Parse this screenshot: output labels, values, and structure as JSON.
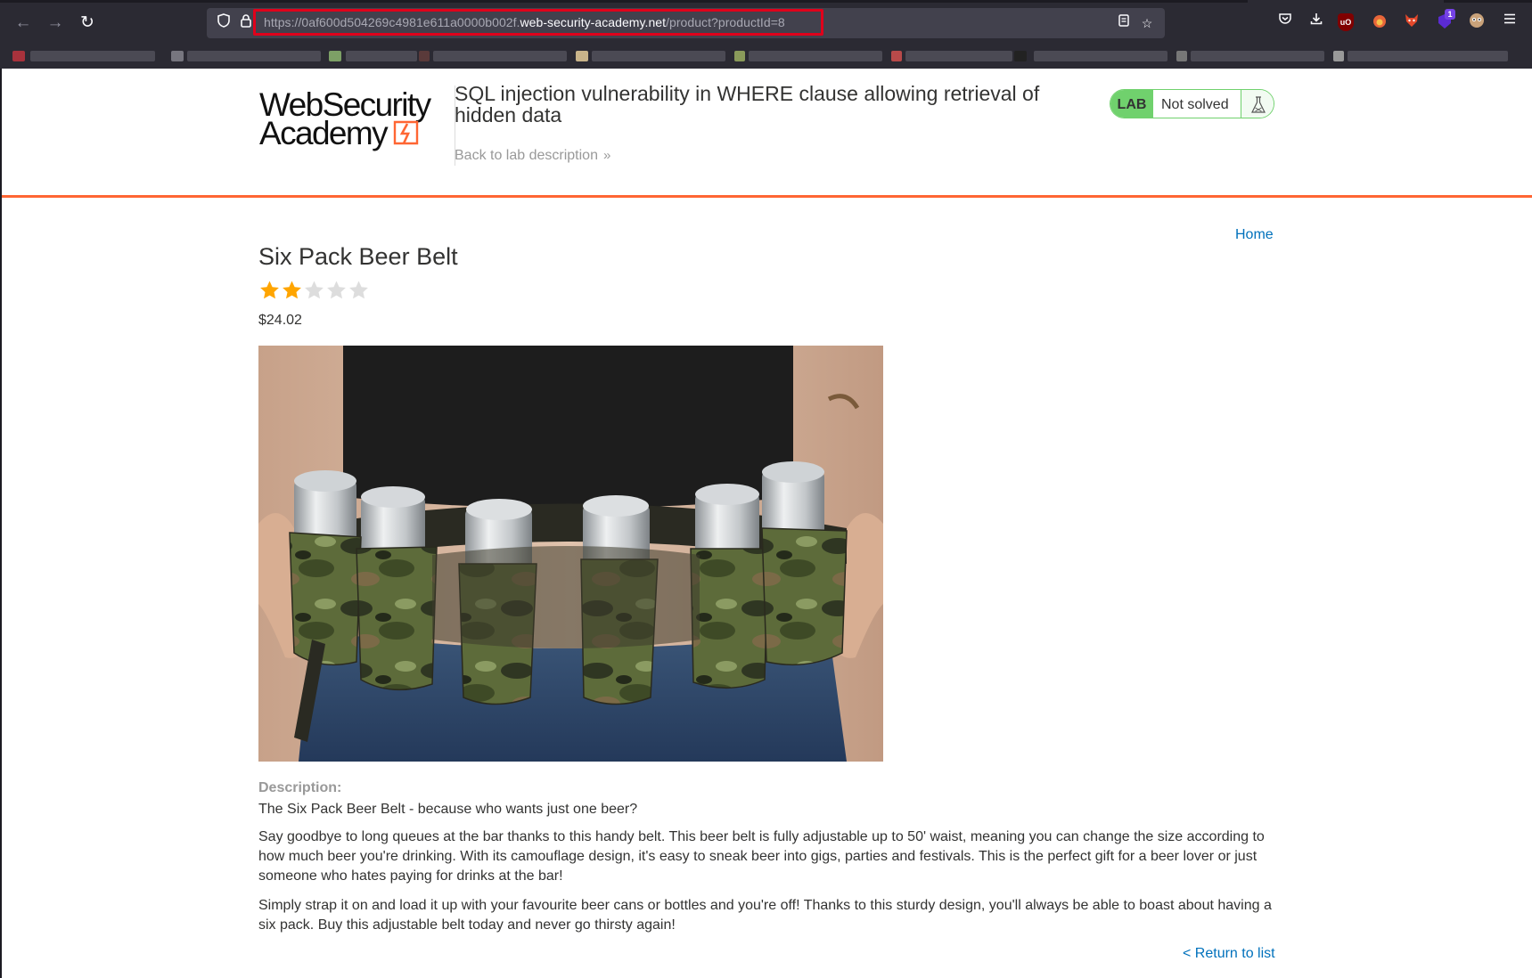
{
  "browser": {
    "url_prefix": "https://0af600d504269c4981e611a0000b002f.",
    "url_domain": "web-security-academy.net",
    "url_path": "/product?productId=8",
    "extension_badge": "1"
  },
  "header": {
    "logo_line1": "WebSecurity",
    "logo_line2": "Academy",
    "lab_title": "SQL injection vulnerability in WHERE clause allowing retrieval of hidden data",
    "back_link": "Back to lab description",
    "back_chevron": "»",
    "lab_badge": "LAB",
    "lab_status": "Not solved",
    "brand_color": "#ff6633",
    "lab_badge_color": "#70d16d"
  },
  "nav": {
    "home": "Home"
  },
  "product": {
    "title": "Six Pack Beer Belt",
    "rating": 2,
    "rating_max": 5,
    "price": "$24.02",
    "description_label": "Description:",
    "description": [
      "The Six Pack Beer Belt - because who wants just one beer?",
      "Say goodbye to long queues at the bar thanks to this handy belt. This beer belt is fully adjustable up to 50' waist, meaning you can change the size according to how much beer you're drinking. With its camouflage design, it's easy to sneak beer into gigs, parties and festivals. This is the perfect gift for a beer lover or just someone who hates paying for drinks at the bar!",
      "Simply strap it on and load it up with your favourite beer cans or bottles and you're off! Thanks to this sturdy design, you'll always be able to boast about having a six pack. Buy this adjustable belt today and never go thirsty again!"
    ],
    "return_link": "< Return to list",
    "star_filled_color": "#ffa500",
    "star_empty_color": "#dddddd"
  }
}
